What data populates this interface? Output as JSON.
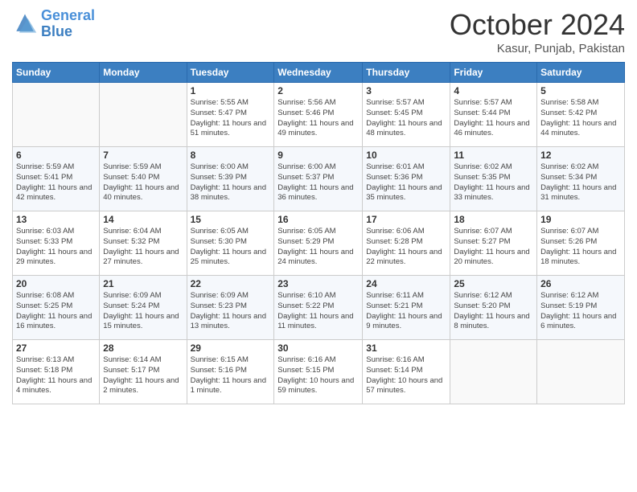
{
  "logo": {
    "line1": "General",
    "line2": "Blue"
  },
  "title": "October 2024",
  "subtitle": "Kasur, Punjab, Pakistan",
  "days_of_week": [
    "Sunday",
    "Monday",
    "Tuesday",
    "Wednesday",
    "Thursday",
    "Friday",
    "Saturday"
  ],
  "weeks": [
    [
      {
        "day": "",
        "info": ""
      },
      {
        "day": "",
        "info": ""
      },
      {
        "day": "1",
        "info": "Sunrise: 5:55 AM\nSunset: 5:47 PM\nDaylight: 11 hours and 51 minutes."
      },
      {
        "day": "2",
        "info": "Sunrise: 5:56 AM\nSunset: 5:46 PM\nDaylight: 11 hours and 49 minutes."
      },
      {
        "day": "3",
        "info": "Sunrise: 5:57 AM\nSunset: 5:45 PM\nDaylight: 11 hours and 48 minutes."
      },
      {
        "day": "4",
        "info": "Sunrise: 5:57 AM\nSunset: 5:44 PM\nDaylight: 11 hours and 46 minutes."
      },
      {
        "day": "5",
        "info": "Sunrise: 5:58 AM\nSunset: 5:42 PM\nDaylight: 11 hours and 44 minutes."
      }
    ],
    [
      {
        "day": "6",
        "info": "Sunrise: 5:59 AM\nSunset: 5:41 PM\nDaylight: 11 hours and 42 minutes."
      },
      {
        "day": "7",
        "info": "Sunrise: 5:59 AM\nSunset: 5:40 PM\nDaylight: 11 hours and 40 minutes."
      },
      {
        "day": "8",
        "info": "Sunrise: 6:00 AM\nSunset: 5:39 PM\nDaylight: 11 hours and 38 minutes."
      },
      {
        "day": "9",
        "info": "Sunrise: 6:00 AM\nSunset: 5:37 PM\nDaylight: 11 hours and 36 minutes."
      },
      {
        "day": "10",
        "info": "Sunrise: 6:01 AM\nSunset: 5:36 PM\nDaylight: 11 hours and 35 minutes."
      },
      {
        "day": "11",
        "info": "Sunrise: 6:02 AM\nSunset: 5:35 PM\nDaylight: 11 hours and 33 minutes."
      },
      {
        "day": "12",
        "info": "Sunrise: 6:02 AM\nSunset: 5:34 PM\nDaylight: 11 hours and 31 minutes."
      }
    ],
    [
      {
        "day": "13",
        "info": "Sunrise: 6:03 AM\nSunset: 5:33 PM\nDaylight: 11 hours and 29 minutes."
      },
      {
        "day": "14",
        "info": "Sunrise: 6:04 AM\nSunset: 5:32 PM\nDaylight: 11 hours and 27 minutes."
      },
      {
        "day": "15",
        "info": "Sunrise: 6:05 AM\nSunset: 5:30 PM\nDaylight: 11 hours and 25 minutes."
      },
      {
        "day": "16",
        "info": "Sunrise: 6:05 AM\nSunset: 5:29 PM\nDaylight: 11 hours and 24 minutes."
      },
      {
        "day": "17",
        "info": "Sunrise: 6:06 AM\nSunset: 5:28 PM\nDaylight: 11 hours and 22 minutes."
      },
      {
        "day": "18",
        "info": "Sunrise: 6:07 AM\nSunset: 5:27 PM\nDaylight: 11 hours and 20 minutes."
      },
      {
        "day": "19",
        "info": "Sunrise: 6:07 AM\nSunset: 5:26 PM\nDaylight: 11 hours and 18 minutes."
      }
    ],
    [
      {
        "day": "20",
        "info": "Sunrise: 6:08 AM\nSunset: 5:25 PM\nDaylight: 11 hours and 16 minutes."
      },
      {
        "day": "21",
        "info": "Sunrise: 6:09 AM\nSunset: 5:24 PM\nDaylight: 11 hours and 15 minutes."
      },
      {
        "day": "22",
        "info": "Sunrise: 6:09 AM\nSunset: 5:23 PM\nDaylight: 11 hours and 13 minutes."
      },
      {
        "day": "23",
        "info": "Sunrise: 6:10 AM\nSunset: 5:22 PM\nDaylight: 11 hours and 11 minutes."
      },
      {
        "day": "24",
        "info": "Sunrise: 6:11 AM\nSunset: 5:21 PM\nDaylight: 11 hours and 9 minutes."
      },
      {
        "day": "25",
        "info": "Sunrise: 6:12 AM\nSunset: 5:20 PM\nDaylight: 11 hours and 8 minutes."
      },
      {
        "day": "26",
        "info": "Sunrise: 6:12 AM\nSunset: 5:19 PM\nDaylight: 11 hours and 6 minutes."
      }
    ],
    [
      {
        "day": "27",
        "info": "Sunrise: 6:13 AM\nSunset: 5:18 PM\nDaylight: 11 hours and 4 minutes."
      },
      {
        "day": "28",
        "info": "Sunrise: 6:14 AM\nSunset: 5:17 PM\nDaylight: 11 hours and 2 minutes."
      },
      {
        "day": "29",
        "info": "Sunrise: 6:15 AM\nSunset: 5:16 PM\nDaylight: 11 hours and 1 minute."
      },
      {
        "day": "30",
        "info": "Sunrise: 6:16 AM\nSunset: 5:15 PM\nDaylight: 10 hours and 59 minutes."
      },
      {
        "day": "31",
        "info": "Sunrise: 6:16 AM\nSunset: 5:14 PM\nDaylight: 10 hours and 57 minutes."
      },
      {
        "day": "",
        "info": ""
      },
      {
        "day": "",
        "info": ""
      }
    ]
  ]
}
